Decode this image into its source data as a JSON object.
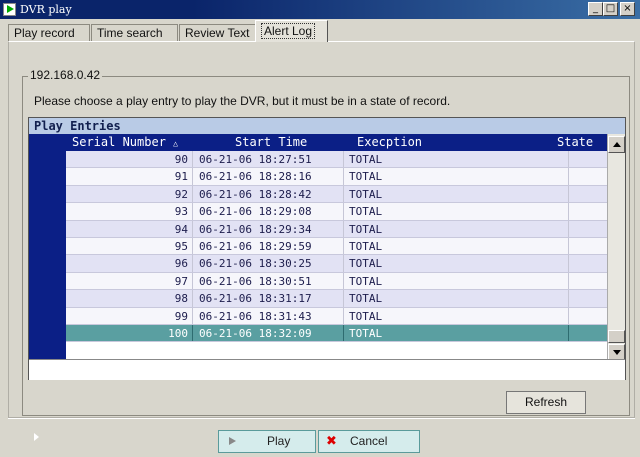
{
  "window": {
    "title": "DVR play",
    "minimize": "_",
    "maximize": "□",
    "close": "×"
  },
  "tabs": [
    {
      "label": "Play record",
      "active": false
    },
    {
      "label": "Time search",
      "active": false
    },
    {
      "label": "Review Text",
      "active": false
    },
    {
      "label": "Alert Log",
      "active": true
    }
  ],
  "group": {
    "legend": "192.168.0.42",
    "instruction": "Please choose a play entry to play the DVR, but it must be in a state of record."
  },
  "table": {
    "title": "Play Entries",
    "columns": {
      "serial": "Serial Number",
      "sort_indicator": "△",
      "start": "Start Time",
      "exception": "Execption",
      "state": "State"
    },
    "rows": [
      {
        "serial": "90",
        "start": "06-21-06 18:27:51",
        "exception": "TOTAL",
        "state": ""
      },
      {
        "serial": "91",
        "start": "06-21-06 18:28:16",
        "exception": "TOTAL",
        "state": ""
      },
      {
        "serial": "92",
        "start": "06-21-06 18:28:42",
        "exception": "TOTAL",
        "state": ""
      },
      {
        "serial": "93",
        "start": "06-21-06 18:29:08",
        "exception": "TOTAL",
        "state": ""
      },
      {
        "serial": "94",
        "start": "06-21-06 18:29:34",
        "exception": "TOTAL",
        "state": ""
      },
      {
        "serial": "95",
        "start": "06-21-06 18:29:59",
        "exception": "TOTAL",
        "state": ""
      },
      {
        "serial": "96",
        "start": "06-21-06 18:30:25",
        "exception": "TOTAL",
        "state": ""
      },
      {
        "serial": "97",
        "start": "06-21-06 18:30:51",
        "exception": "TOTAL",
        "state": ""
      },
      {
        "serial": "98",
        "start": "06-21-06 18:31:17",
        "exception": "TOTAL",
        "state": ""
      },
      {
        "serial": "99",
        "start": "06-21-06 18:31:43",
        "exception": "TOTAL",
        "state": ""
      },
      {
        "serial": "100",
        "start": "06-21-06 18:32:09",
        "exception": "TOTAL",
        "state": "",
        "selected": true
      }
    ]
  },
  "buttons": {
    "refresh": "Refresh",
    "play": "Play",
    "cancel": "Cancel",
    "cancel_icon": "✖"
  },
  "colors": {
    "header_bg": "#0b1f86",
    "title_band": "#b9cbe6",
    "row_selected": "#5a9fa1",
    "button_bg": "#d5ecec"
  },
  "icons": {
    "app": "play-icon",
    "play": "play-triangle-icon",
    "cancel": "red-x-icon",
    "row_pointer": "row-pointer-icon"
  }
}
